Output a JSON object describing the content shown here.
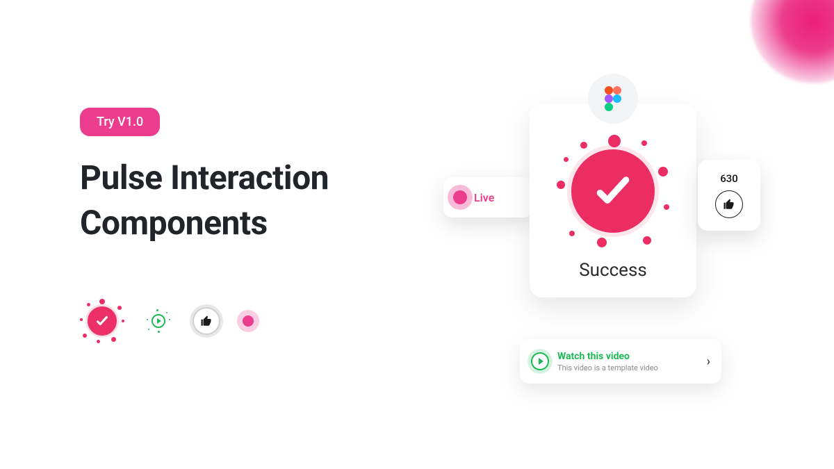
{
  "header": {
    "try_badge": "Try V1.0",
    "title_line1": "Pulse Interaction",
    "title_line2": "Components"
  },
  "live": {
    "label": "Live"
  },
  "success": {
    "label": "Success"
  },
  "likes": {
    "count": "630"
  },
  "video": {
    "title": "Watch this video",
    "subtitle": "This video is a template video"
  },
  "colors": {
    "pink": "#ec3c8d",
    "green": "#1db954"
  }
}
